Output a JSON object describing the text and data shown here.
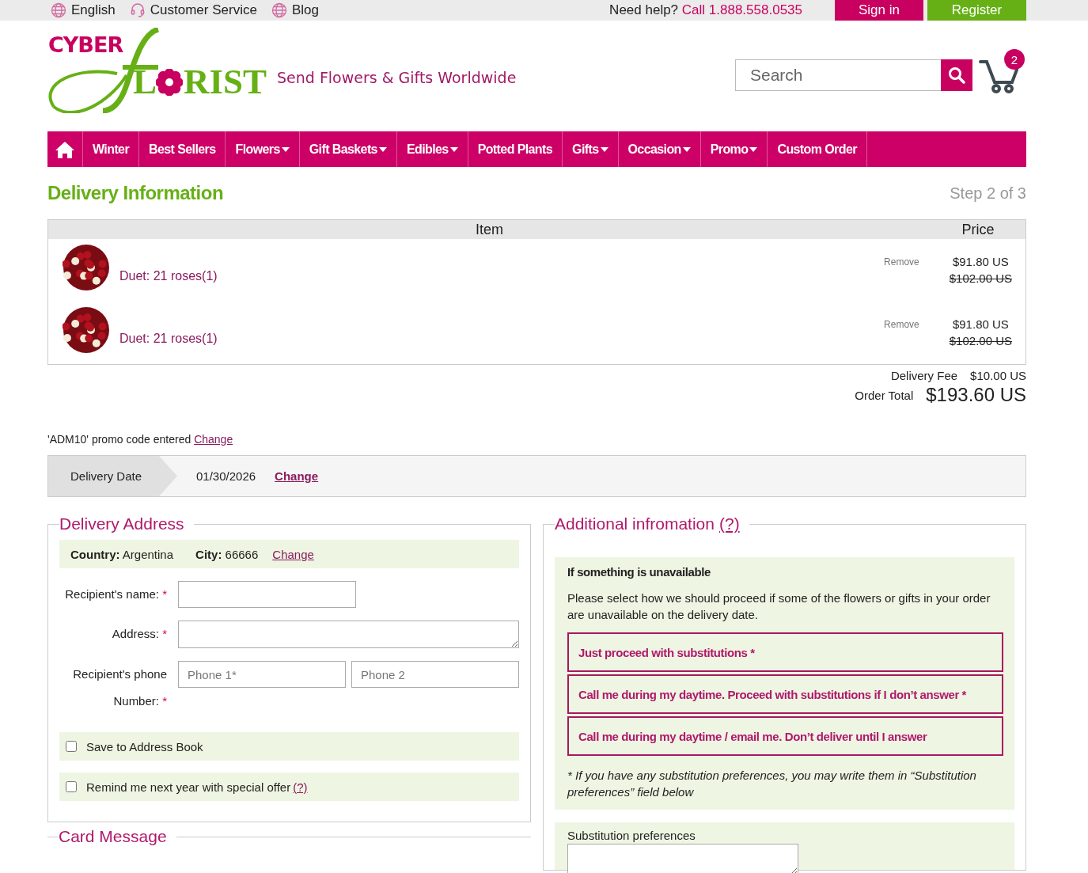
{
  "top_bar": {
    "links": [
      {
        "label": "English",
        "kind": "globe"
      },
      {
        "label": "Customer Service",
        "kind": "headset"
      },
      {
        "label": "Blog",
        "kind": "globe"
      }
    ],
    "help_text": "Need help?",
    "phone": "Call 1.888.558.0535",
    "sign_in": "Sign in",
    "register": "Register"
  },
  "logo": {
    "top": "CYBER",
    "bottom_left": "L",
    "bottom_right": "RIST"
  },
  "tagline": "Send Flowers & Gifts Worldwide",
  "search": {
    "placeholder": "Search"
  },
  "cart": {
    "count": "2"
  },
  "nav": [
    {
      "label": "Winter",
      "dropdown": false
    },
    {
      "label": "Best Sellers",
      "dropdown": false
    },
    {
      "label": "Flowers",
      "dropdown": true
    },
    {
      "label": "Gift Baskets",
      "dropdown": true
    },
    {
      "label": "Edibles",
      "dropdown": true
    },
    {
      "label": "Potted Plants",
      "dropdown": false
    },
    {
      "label": "Gifts",
      "dropdown": true
    },
    {
      "label": "Occasion",
      "dropdown": true
    },
    {
      "label": "Promo",
      "dropdown": true
    },
    {
      "label": "Custom Order",
      "dropdown": false
    }
  ],
  "page_title": "Delivery Information",
  "step": "Step 2 of 3",
  "cart_table": {
    "columns": [
      "Item",
      "Price"
    ],
    "rows": [
      {
        "name": "Duet: 21 roses(1)",
        "remove": "Remove",
        "price": "$91.80 US",
        "old_price": "$102.00 US"
      },
      {
        "name": "Duet: 21 roses(1)",
        "remove": "Remove",
        "price": "$91.80 US",
        "old_price": "$102.00 US"
      }
    ]
  },
  "totals": {
    "fee_label": "Delivery Fee",
    "fee": "$10.00 US",
    "total_label": "Order Total",
    "total": "$193.60 US"
  },
  "promo": {
    "text": "'ADM10' promo code entered",
    "link": "Change"
  },
  "delivery_date": {
    "label": "Delivery Date",
    "value": "01/30/2026",
    "link": "Change"
  },
  "delivery_address": {
    "legend": "Delivery Address",
    "country_label": "Country:",
    "country": "Argentina",
    "city_label": "City:",
    "city": "66666",
    "link": "Change",
    "name_label": "Recipient's name:",
    "address_label": "Address:",
    "phone_label": "Recipient's phone",
    "phone_label_2": "Number:",
    "required_mark": "*",
    "phones": [
      {
        "placeholder": "Phone 1*"
      },
      {
        "placeholder": "Phone 2"
      }
    ],
    "checks": [
      {
        "label": "Save to Address Book",
        "checked": false
      },
      {
        "label": "Remind me next year with special offer",
        "help": "(?)",
        "checked": false
      }
    ]
  },
  "additional": {
    "legend": "Additional infromation",
    "help": "(?)",
    "heading": "If something is unavailable",
    "text": "Please select how we should proceed if some of the flowers or gifts in your order are unavailable on the delivery date.",
    "options": [
      "Just proceed with substitutions *",
      "Call me during my daytime. Proceed with substitutions if I don’t answer *",
      "Call me during my daytime / email me. Don’t deliver until I answer"
    ],
    "note": "* If you have any substitution preferences, you may write them in “Substitution preferences” field below",
    "pref_label": "Substitution preferences"
  },
  "card_message": {
    "legend": "Card Message"
  }
}
